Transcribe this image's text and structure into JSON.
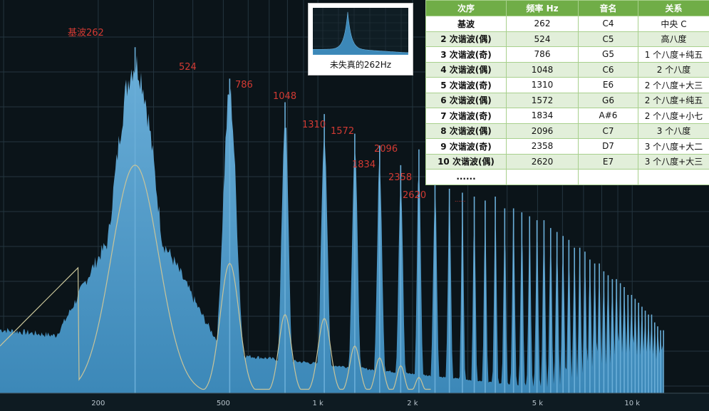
{
  "chart_data": {
    "type": "area",
    "x_scale": "log",
    "xlim": [
      120,
      20000
    ],
    "ylim": [
      0,
      1
    ],
    "grid": true,
    "x_ticks": [
      "200",
      "500",
      "1 k",
      "2 k",
      "5 k",
      "10 k"
    ],
    "x_tick_values": [
      200,
      500,
      1000,
      2000,
      5000,
      10000
    ],
    "peak_labels": [
      "基波262",
      "524",
      "786",
      "1048",
      "1310",
      "1572",
      "1834",
      "2096",
      "2358",
      "2620",
      "......"
    ],
    "series": [
      {
        "x": [
          262,
          524,
          786,
          1048,
          1310,
          1572,
          1834,
          2096,
          2358,
          2620,
          2882,
          3144,
          3406,
          3668,
          3930,
          4192,
          4454,
          4716,
          4978,
          5240,
          5502,
          5764,
          6026,
          6288,
          6550,
          6812,
          7074,
          7336,
          7598,
          7860,
          8122,
          8384,
          8646,
          8908,
          9170,
          9432,
          9694,
          9956,
          10218,
          10480,
          10742,
          11004,
          11266,
          11528,
          11790,
          12052,
          12314,
          12576,
          12838,
          13100,
          13362
        ],
        "values": [
          0.88,
          0.8,
          0.74,
          0.71,
          0.66,
          0.63,
          0.58,
          0.62,
          0.55,
          0.52,
          0.51,
          0.5,
          0.49,
          0.5,
          0.47,
          0.47,
          0.46,
          0.45,
          0.44,
          0.44,
          0.42,
          0.41,
          0.4,
          0.39,
          0.37,
          0.37,
          0.36,
          0.34,
          0.33,
          0.33,
          0.31,
          0.3,
          0.29,
          0.29,
          0.28,
          0.27,
          0.25,
          0.25,
          0.24,
          0.23,
          0.22,
          0.21,
          0.2,
          0.2,
          0.18,
          0.17,
          0.16,
          0.16,
          0.14,
          0.13,
          0.12
        ]
      },
      {
        "x": [
          262,
          524,
          786,
          1048,
          1310,
          1572,
          1834,
          2096
        ],
        "values": [
          0.58,
          0.33,
          0.2,
          0.19,
          0.12,
          0.09,
          0.07,
          0.04
        ]
      }
    ]
  },
  "inset": {
    "caption": "未失真的262Hz"
  },
  "table": {
    "headers": [
      "次序",
      "频率 Hz",
      "音名",
      "关系"
    ],
    "rows": [
      [
        "基波",
        "262",
        "C4",
        "中央 C"
      ],
      [
        "2 次谐波(偶)",
        "524",
        "C5",
        "高八度"
      ],
      [
        "3 次谐波(奇)",
        "786",
        "G5",
        "1 个八度+纯五"
      ],
      [
        "4 次谐波(偶)",
        "1048",
        "C6",
        "2 个八度"
      ],
      [
        "5 次谐波(奇)",
        "1310",
        "E6",
        "2 个八度+大三"
      ],
      [
        "6 次谐波(偶)",
        "1572",
        "G6",
        "2 个八度+纯五"
      ],
      [
        "7 次谐波(奇)",
        "1834",
        "A#6",
        "2 个八度+小七"
      ],
      [
        "8 次谐波(偶)",
        "2096",
        "C7",
        "3 个八度"
      ],
      [
        "9 次谐波(奇)",
        "2358",
        "D7",
        "3 个八度+大二"
      ],
      [
        "10 次谐波(偶)",
        "2620",
        "E7",
        "3 个八度+大三"
      ],
      [
        "......",
        "",
        "",
        ""
      ]
    ]
  },
  "colors": {
    "background": "#0b1419",
    "grid": "#24353f",
    "spectrum_fill": "#3c88b8",
    "spectrum_top": "#6aaed8",
    "envelope": "#c9c499",
    "label": "#d23a33",
    "table_header": "#70ad47"
  }
}
